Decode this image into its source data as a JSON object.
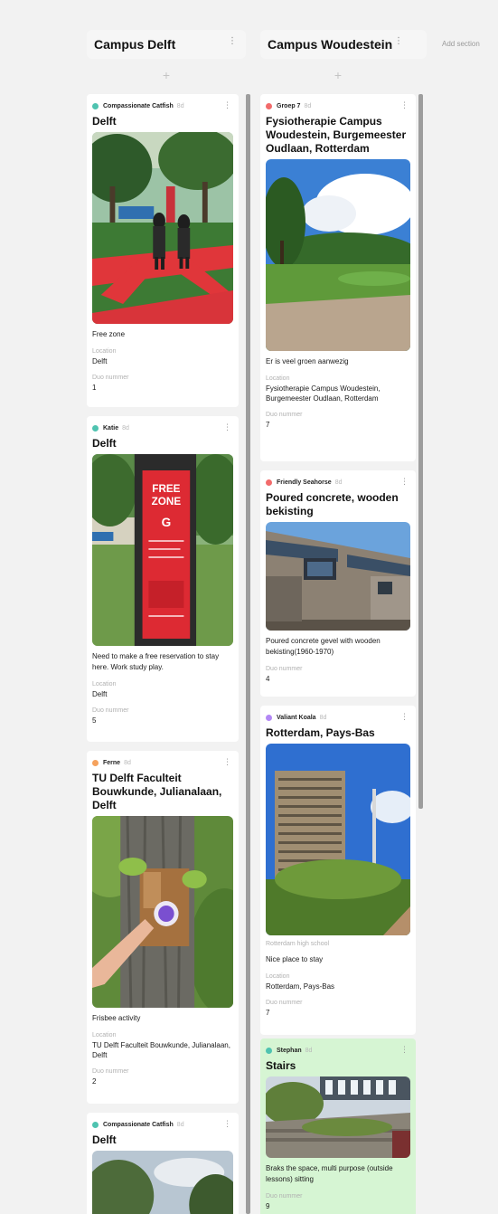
{
  "board": {
    "add_section_label": "Add section"
  },
  "icons": {
    "column_menu": "more-vertical-icon",
    "card_menu": "more-vertical-icon",
    "add": "plus-icon"
  },
  "columns": [
    {
      "title": "Campus Delft",
      "add_label": "+",
      "cards": [
        {
          "author": "Compassionate Catfish",
          "time": "8d",
          "dot_color": "#4fc3b0",
          "title": "Delft",
          "description": "Free zone",
          "location_label": "Location",
          "location": "Delft",
          "duo_label": "Duo nummer",
          "duo": "1"
        },
        {
          "author": "Katie",
          "time": "8d",
          "dot_color": "#4fc3b0",
          "title": "Delft",
          "description": "Need to make a free reservation to stay here. Work study play.",
          "location_label": "Location",
          "location": "Delft",
          "duo_label": "Duo nummer",
          "duo": "5"
        },
        {
          "author": "Ferne",
          "time": "8d",
          "dot_color": "#f5a25d",
          "title": "TU Delft Faculteit Bouwkunde, Julianalaan, Delft",
          "description": "Frisbee activity",
          "location_label": "Location",
          "location": "TU Delft Faculteit Bouwkunde, Julianalaan, Delft",
          "duo_label": "Duo nummer",
          "duo": "2"
        },
        {
          "author": "Compassionate Catfish",
          "time": "8d",
          "dot_color": "#4fc3b0",
          "title": "Delft"
        }
      ]
    },
    {
      "title": "Campus Woudestein",
      "add_label": "+",
      "cards": [
        {
          "author": "Groep 7",
          "time": "8d",
          "dot_color": "#f26b6b",
          "title": "Fysiotherapie Campus Woudestein, Burgemeester Oudlaan, Rotterdam",
          "description": "Er is veel groen aanwezig",
          "location_label": "Location",
          "location": "Fysiotherapie Campus Woudestein, Burgemeester Oudlaan, Rotterdam",
          "duo_label": "Duo nummer",
          "duo": "7"
        },
        {
          "author": "Friendly Seahorse",
          "time": "8d",
          "dot_color": "#f26b6b",
          "title": "Poured concrete, wooden bekisting",
          "description": "Poured concrete gevel with wooden bekisting(1960-1970)",
          "duo_label": "Duo nummer",
          "duo": "4"
        },
        {
          "author": "Valiant Koala",
          "time": "8d",
          "dot_color": "#b388f5",
          "title": "Rotterdam, Pays-Bas",
          "subtitle": "Rotterdam high school",
          "description": "Nice place to stay",
          "location_label": "Location",
          "location": "Rotterdam, Pays-Bas",
          "duo_label": "Duo nummer",
          "duo": "7"
        },
        {
          "author": "Stephan",
          "time": "8d",
          "dot_color": "#4fc3b0",
          "title": "Stairs",
          "description": "Braks the space, multi purpose (outside lessons) sitting",
          "duo_label": "Duo nummer",
          "duo": "9"
        }
      ]
    }
  ]
}
